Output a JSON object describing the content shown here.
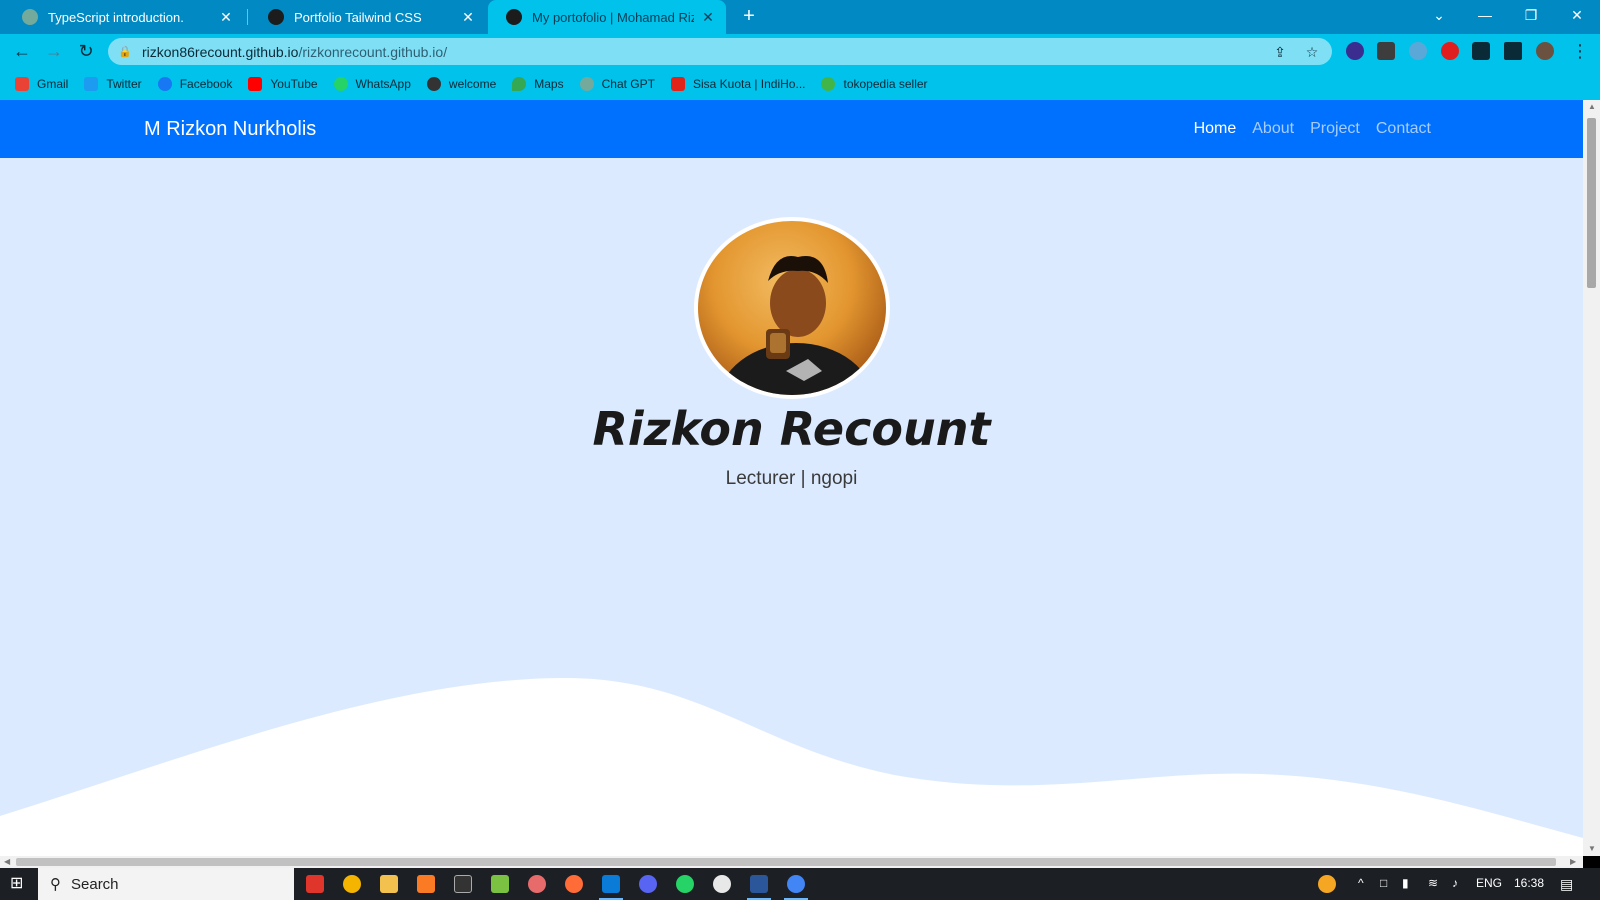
{
  "browser": {
    "tabs": [
      {
        "title": "TypeScript introduction.",
        "active": false
      },
      {
        "title": "Portfolio Tailwind CSS",
        "active": false
      },
      {
        "title": "My portofolio | Mohamad Rizkon",
        "active": true
      }
    ],
    "tab_close_glyph": "✕",
    "new_tab_glyph": "+",
    "window_controls": {
      "chevron": "⌄",
      "minimize": "—",
      "restore": "❐",
      "close": "✕"
    },
    "url_host": "rizkon86recount.github.io",
    "url_path": "/rizkonrecount.github.io/",
    "toolbar_glyphs": {
      "back": "←",
      "forward": "→",
      "reload": "↻",
      "share": "⇪",
      "star": "☆",
      "menu": "⋮"
    },
    "bookmarks": [
      {
        "label": "Gmail",
        "icon": "gmail-icon",
        "color": "#ea4335"
      },
      {
        "label": "Twitter",
        "icon": "twitter-icon",
        "color": "#1d9bf0"
      },
      {
        "label": "Facebook",
        "icon": "facebook-icon",
        "color": "#1877f2"
      },
      {
        "label": "YouTube",
        "icon": "youtube-icon",
        "color": "#ff0000"
      },
      {
        "label": "WhatsApp",
        "icon": "whatsapp-icon",
        "color": "#25d366"
      },
      {
        "label": "welcome",
        "icon": "globe-icon",
        "color": "#333333"
      },
      {
        "label": "Maps",
        "icon": "maps-icon",
        "color": "#34a853"
      },
      {
        "label": "Chat GPT",
        "icon": "chatgpt-icon",
        "color": "#74aa9c"
      },
      {
        "label": "Sisa Kuota | IndiHo...",
        "icon": "indihome-icon",
        "color": "#e2231a"
      },
      {
        "label": "tokopedia seller",
        "icon": "tokopedia-icon",
        "color": "#42b549"
      }
    ]
  },
  "site": {
    "brand": "M Rizkon Nurkholis",
    "nav": [
      {
        "label": "Home",
        "current": true
      },
      {
        "label": "About",
        "current": false
      },
      {
        "label": "Project",
        "current": false
      },
      {
        "label": "Contact",
        "current": false
      }
    ],
    "hero": {
      "name": "Rizkon Recount",
      "tagline": "Lecturer | ngopi"
    },
    "colors": {
      "nav_bg": "#0070ff",
      "page_bg": "#dceaff",
      "wave": "#ffffff"
    }
  },
  "taskbar": {
    "search_label": "Search",
    "language": "ENG",
    "time": "16:38"
  }
}
